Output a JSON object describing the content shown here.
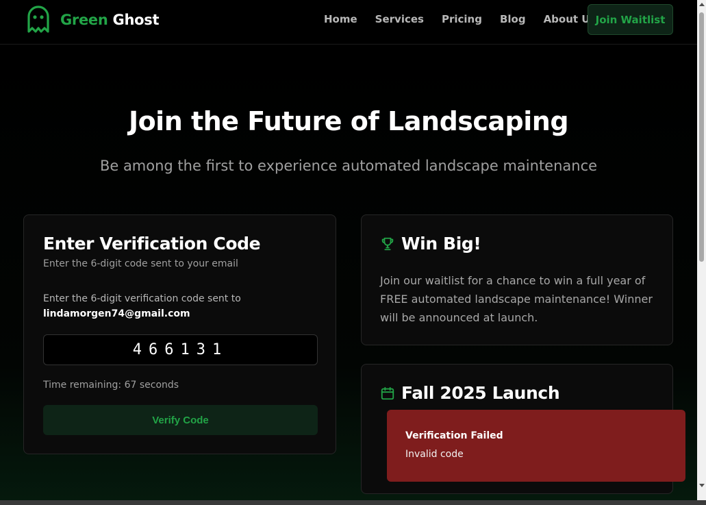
{
  "header": {
    "brand_green": "Green",
    "brand_white": "Ghost",
    "nav": [
      "Home",
      "Services",
      "Pricing",
      "Blog",
      "About Us"
    ],
    "cta_label": "Join Waitlist"
  },
  "hero": {
    "title": "Join the Future of Landscaping",
    "subtitle": "Be among the first to experience automated landscape maintenance"
  },
  "verify": {
    "title": "Enter Verification Code",
    "subtitle": "Enter the 6-digit code sent to your email",
    "info": "Enter the 6-digit verification code sent to",
    "email": "lindamorgen74@gmail.com",
    "code_value": "466131",
    "timer": "Time remaining: 67 seconds",
    "button_label": "Verify Code"
  },
  "win": {
    "title": "Win Big!",
    "body": "Join our waitlist for a chance to win a full year of FREE automated landscape maintenance! Winner will be announced at launch.",
    "icon": "trophy-icon"
  },
  "launch": {
    "title": "Fall 2025 Launch",
    "icon": "calendar-icon"
  },
  "toast": {
    "title": "Verification Failed",
    "message": "Invalid code"
  },
  "colors": {
    "accent": "#22a447",
    "button_bg": "#0e2417",
    "toast_bg": "#7f1d1d"
  }
}
